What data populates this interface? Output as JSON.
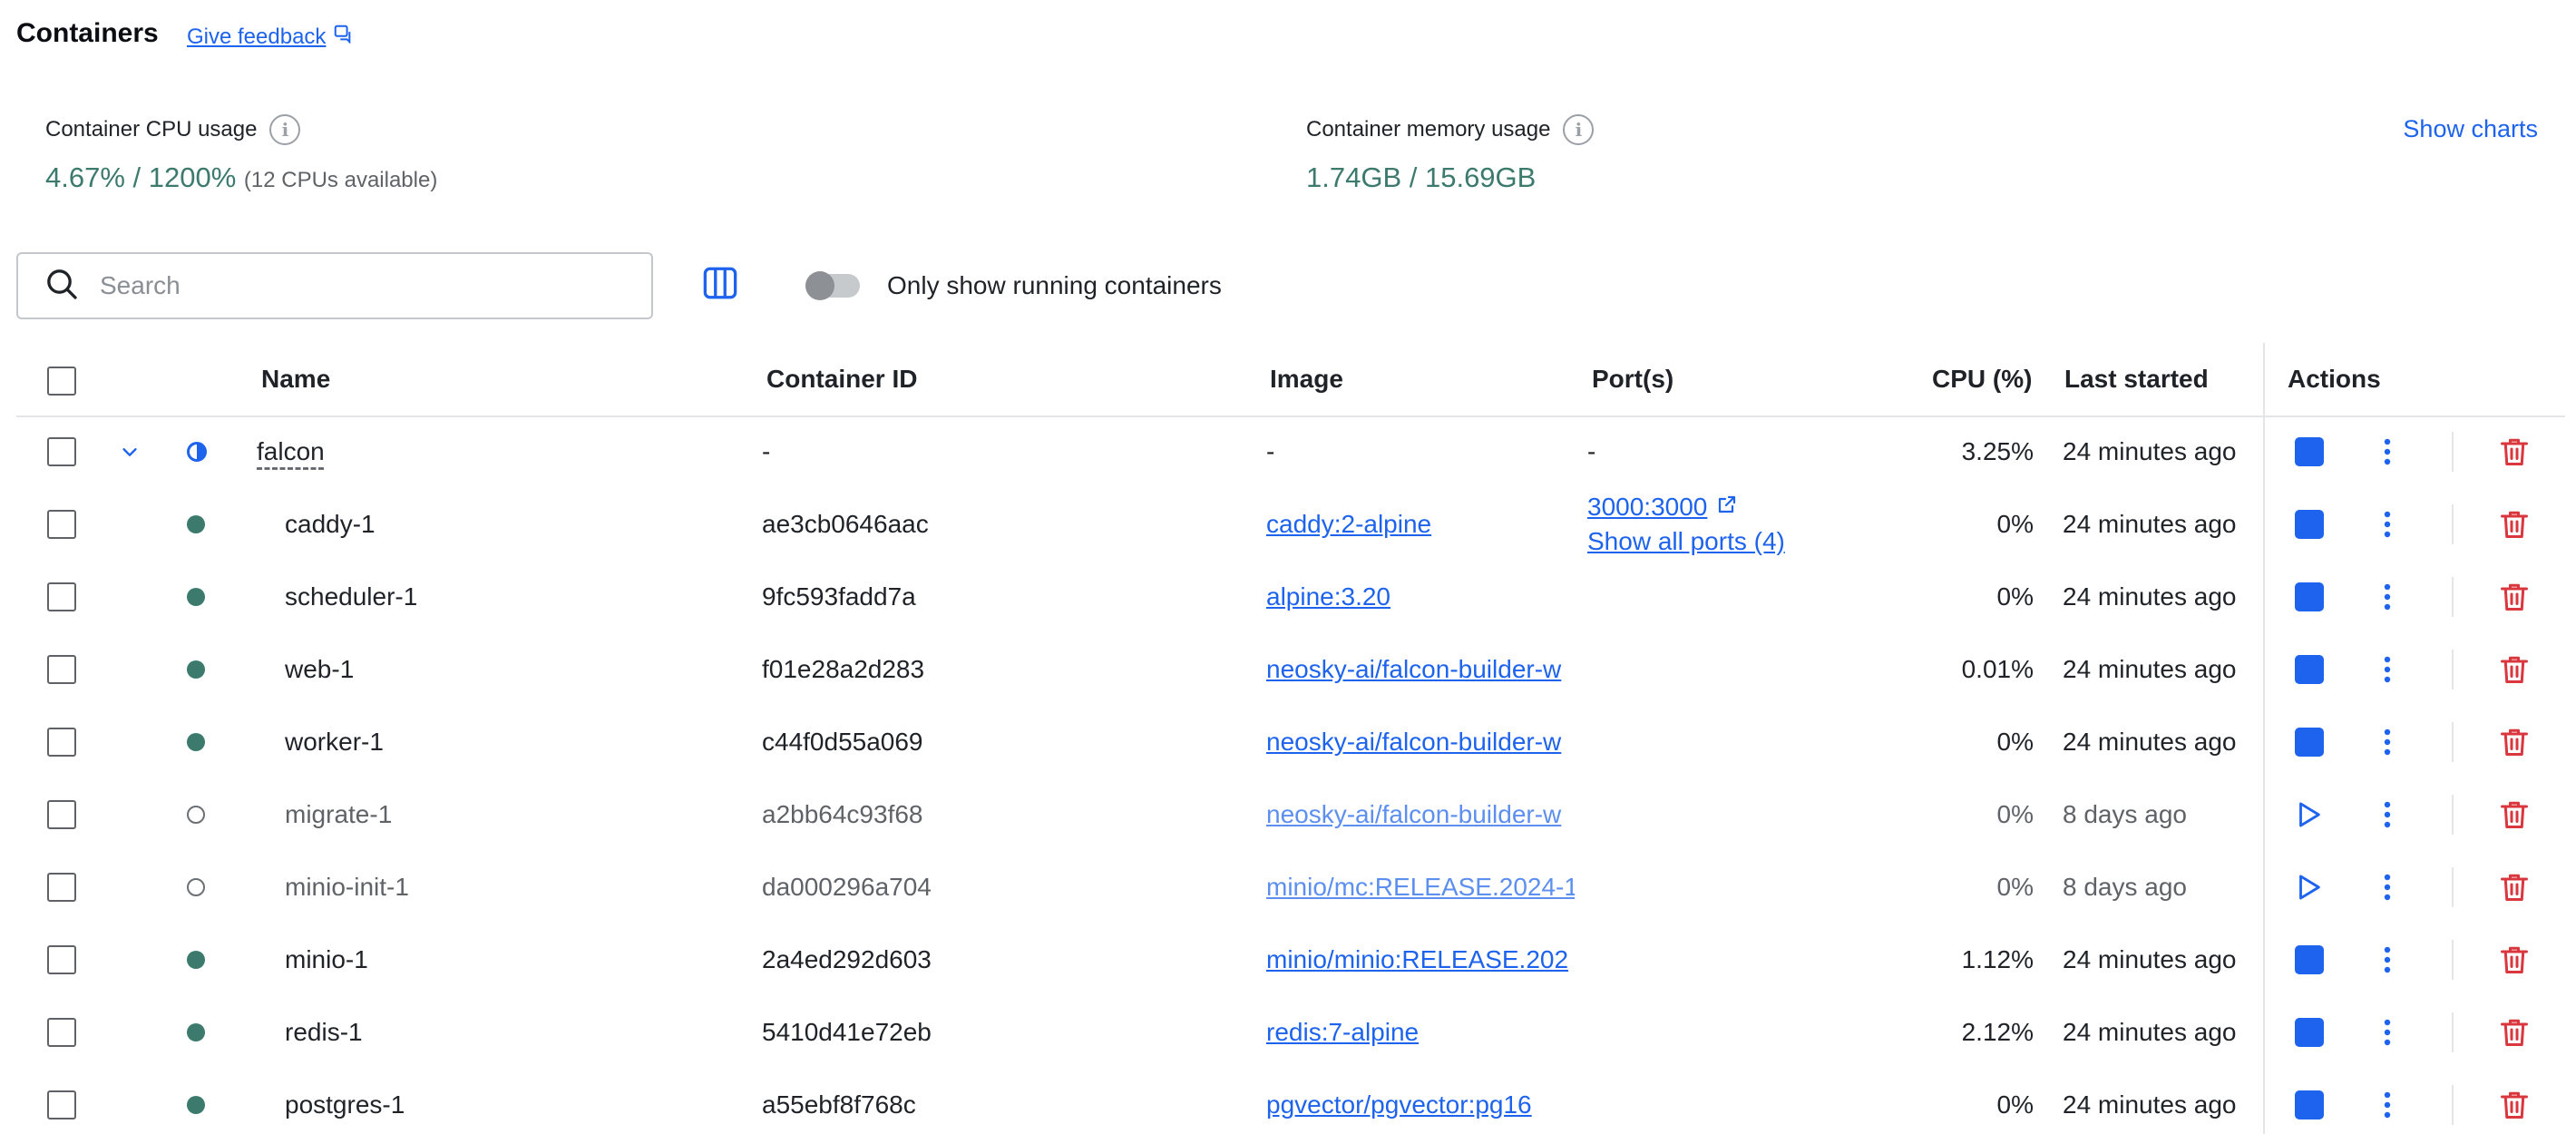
{
  "header": {
    "title": "Containers",
    "feedback_label": "Give feedback"
  },
  "stats": {
    "cpu": {
      "label": "Container CPU usage",
      "used": "4.67%",
      "separator": " / ",
      "total": "1200%",
      "note": "(12 CPUs available)"
    },
    "memory": {
      "label": "Container memory usage",
      "used": "1.74GB",
      "separator": " / ",
      "total": "15.69GB"
    },
    "show_charts_label": "Show charts"
  },
  "toolbar": {
    "search_placeholder": "Search",
    "search_value": "",
    "running_toggle_label": "Only show running containers",
    "running_toggle_on": false
  },
  "table": {
    "columns": {
      "name": "Name",
      "container_id": "Container ID",
      "image": "Image",
      "ports": "Port(s)",
      "cpu": "CPU (%)",
      "last_started": "Last started",
      "actions": "Actions"
    },
    "group": {
      "name": "falcon",
      "container_id": "-",
      "image": "-",
      "ports": "-",
      "cpu": "3.25%",
      "last_started": "24 minutes ago",
      "status": "partial"
    },
    "rows": [
      {
        "name": "caddy-1",
        "container_id": "ae3cb0646aac",
        "image": "caddy:2-alpine",
        "port": "3000:3000",
        "show_all_ports": "Show all ports (4)",
        "cpu": "0%",
        "last_started": "24 minutes ago",
        "status": "running"
      },
      {
        "name": "scheduler-1",
        "container_id": "9fc593fadd7a",
        "image": "alpine:3.20",
        "port": "",
        "show_all_ports": "",
        "cpu": "0%",
        "last_started": "24 minutes ago",
        "status": "running"
      },
      {
        "name": "web-1",
        "container_id": "f01e28a2d283",
        "image": "neosky-ai/falcon-builder-w",
        "port": "",
        "show_all_ports": "",
        "cpu": "0.01%",
        "last_started": "24 minutes ago",
        "status": "running"
      },
      {
        "name": "worker-1",
        "container_id": "c44f0d55a069",
        "image": "neosky-ai/falcon-builder-w",
        "port": "",
        "show_all_ports": "",
        "cpu": "0%",
        "last_started": "24 minutes ago",
        "status": "running"
      },
      {
        "name": "migrate-1",
        "container_id": "a2bb64c93f68",
        "image": "neosky-ai/falcon-builder-w",
        "port": "",
        "show_all_ports": "",
        "cpu": "0%",
        "last_started": "8 days ago",
        "status": "exited"
      },
      {
        "name": "minio-init-1",
        "container_id": "da000296a704",
        "image": "minio/mc:RELEASE.2024-1",
        "port": "",
        "show_all_ports": "",
        "cpu": "0%",
        "last_started": "8 days ago",
        "status": "exited"
      },
      {
        "name": "minio-1",
        "container_id": "2a4ed292d603",
        "image": "minio/minio:RELEASE.202",
        "port": "",
        "show_all_ports": "",
        "cpu": "1.12%",
        "last_started": "24 minutes ago",
        "status": "running"
      },
      {
        "name": "redis-1",
        "container_id": "5410d41e72eb",
        "image": "redis:7-alpine",
        "port": "",
        "show_all_ports": "",
        "cpu": "2.12%",
        "last_started": "24 minutes ago",
        "status": "running"
      },
      {
        "name": "postgres-1",
        "container_id": "a55ebf8f768c",
        "image": "pgvector/pgvector:pg16",
        "port": "",
        "show_all_ports": "",
        "cpu": "0%",
        "last_started": "24 minutes ago",
        "status": "running"
      }
    ]
  },
  "icons": {
    "feedback": "external-feedback-icon",
    "info": "info-icon",
    "search": "search-icon",
    "columns": "columns-icon",
    "expand": "chevron-down-icon",
    "stop": "stop-icon",
    "start": "play-icon",
    "more": "kebab-menu-icon",
    "delete": "trash-icon",
    "open_port": "external-link-icon"
  },
  "colors": {
    "accent": "#1d63ed",
    "running": "#3d7a6e",
    "danger": "#d9363e",
    "usage_value": "#3d7a6e"
  }
}
